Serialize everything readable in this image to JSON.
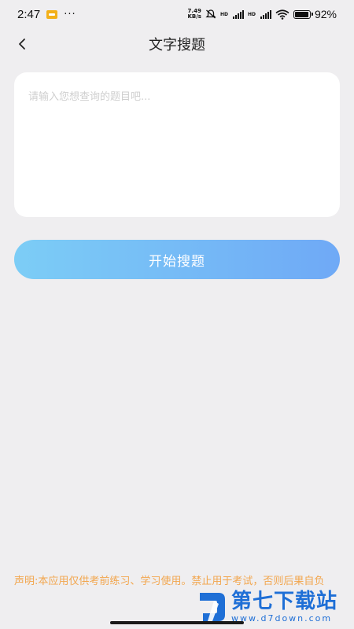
{
  "status_bar": {
    "time": "2:47",
    "more": "···",
    "speed_top": "7.49",
    "speed_bottom": "KB/s",
    "hd1": "HD",
    "hd2": "HD",
    "battery_text": "92%",
    "battery_level": 0.92
  },
  "header": {
    "title": "文字搜题"
  },
  "search": {
    "placeholder": "请输入您想查询的题目吧...",
    "value": "",
    "button_label": "开始搜题"
  },
  "disclaimer": {
    "text": "声明:本应用仅供考前练习、学习使用。禁止用于考试，否则后果自负"
  },
  "watermark": {
    "name": "第七下载站",
    "url": "www.d7down.com"
  },
  "colors": {
    "accent_start": "#7ccdf6",
    "accent_end": "#6fa9f6",
    "disclaimer": "#f2a64e",
    "background": "#efeef0"
  }
}
